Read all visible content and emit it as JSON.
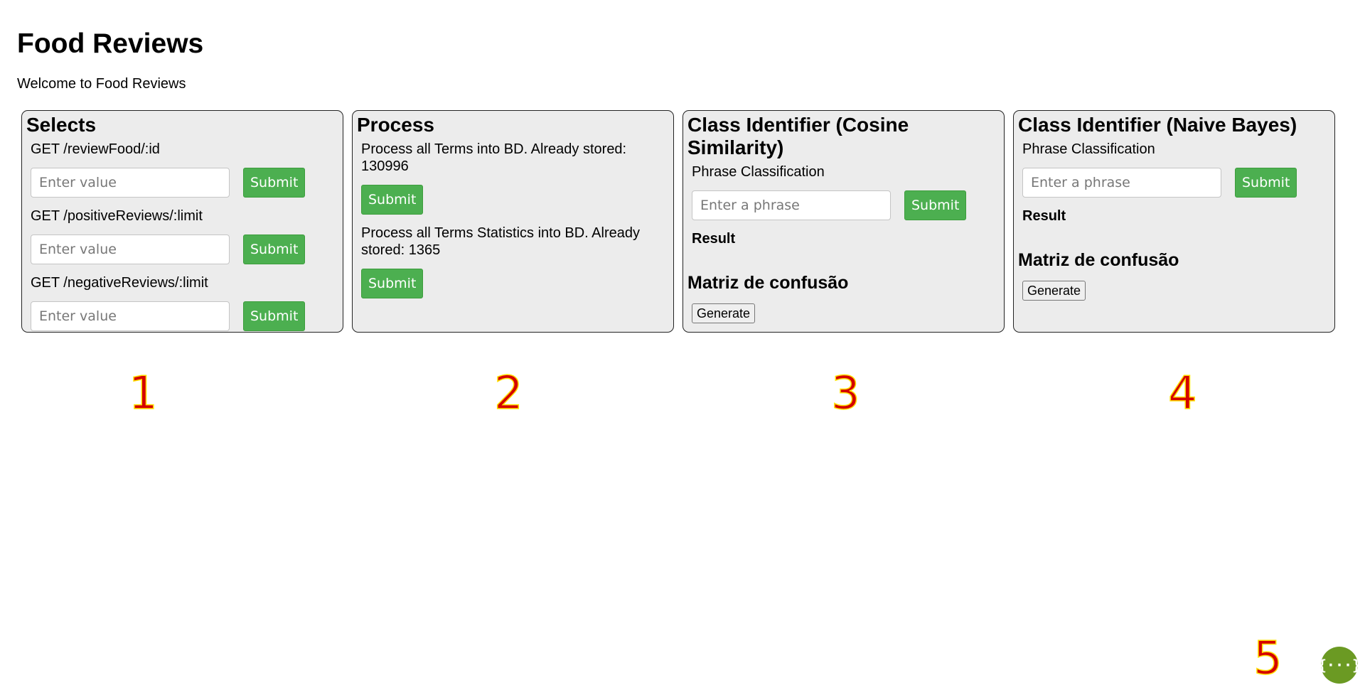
{
  "page": {
    "title": "Food Reviews",
    "welcome": "Welcome to Food Reviews"
  },
  "selects": {
    "heading": "Selects",
    "endpoints": [
      {
        "label": "GET /reviewFood/:id",
        "placeholder": "Enter value",
        "button": "Submit"
      },
      {
        "label": "GET /positiveReviews/:limit",
        "placeholder": "Enter value",
        "button": "Submit"
      },
      {
        "label": "GET /negativeReviews/:limit",
        "placeholder": "Enter value",
        "button": "Submit"
      }
    ]
  },
  "process": {
    "heading": "Process",
    "terms_label": "Process all Terms into BD. Already stored: 130996",
    "terms_button": "Submit",
    "stats_label": "Process all Terms Statistics into BD. Already stored: 1365",
    "stats_button": "Submit"
  },
  "cosine": {
    "heading": "Class Identifier (Cosine Similarity)",
    "phrase_label": "Phrase Classification",
    "placeholder": "Enter a phrase",
    "button": "Submit",
    "result_label": "Result",
    "matrix_heading": "Matriz de confusão",
    "generate_button": "Generate"
  },
  "bayes": {
    "heading": "Class Identifier (Naive Bayes)",
    "phrase_label": "Phrase Classification",
    "placeholder": "Enter a phrase",
    "button": "Submit",
    "result_label": "Result",
    "matrix_heading": "Matriz de confusão",
    "generate_button": "Generate"
  },
  "markers": [
    "1",
    "2",
    "3",
    "4",
    "5"
  ],
  "floating_button": {
    "icon": "curly-braces-icon",
    "glyph": "{···}",
    "color": "#6b9a23"
  },
  "colors": {
    "submit_green": "#4caf50",
    "panel_bg": "#ececec",
    "marker_red": "#d40000",
    "marker_outline": "#ffe000"
  }
}
